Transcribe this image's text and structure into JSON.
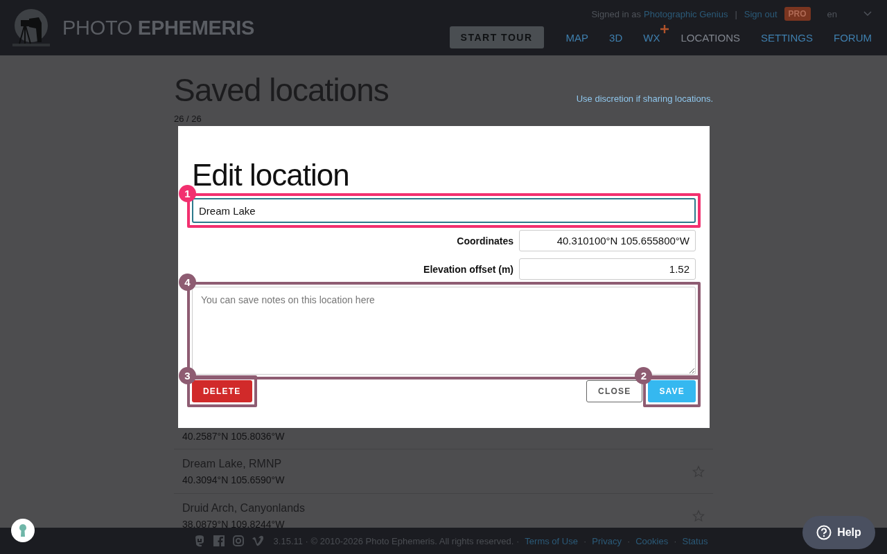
{
  "header": {
    "brand": {
      "light": "PHOTO",
      "bold": "EPHEMERIS"
    },
    "account": {
      "signed_in_label": "Signed in as",
      "user": "Photographic Genius",
      "separator": "|",
      "sign_out": "Sign out",
      "badge": "PRO"
    },
    "language": "en",
    "start_tour": "START TOUR",
    "nav": [
      {
        "label": "MAP",
        "selected": false,
        "new": false
      },
      {
        "label": "3D",
        "selected": false,
        "new": false
      },
      {
        "label": "WX",
        "selected": false,
        "new": true
      },
      {
        "label": "LOCATIONS",
        "selected": true,
        "new": false
      },
      {
        "label": "SETTINGS",
        "selected": false,
        "new": false
      },
      {
        "label": "FORUM",
        "selected": false,
        "new": false
      }
    ]
  },
  "page": {
    "title": "Saved locations",
    "notice": "Use discretion if sharing locations.",
    "count": "26 / 26",
    "locations": [
      {
        "coords": "40.2587°N 105.8036°W"
      },
      {
        "name": "Dream Lake, RMNP",
        "coords": "40.3094°N 105.6590°W",
        "favorite": false
      },
      {
        "name": "Druid Arch, Canyonlands",
        "coords": "38.0879°N 109.8244°W",
        "favorite": false
      }
    ]
  },
  "dialog": {
    "title": "Edit location",
    "name": {
      "value": "Dream Lake",
      "annotation": {
        "label": "1",
        "color": "#f2306f"
      }
    },
    "fields": [
      {
        "label": "Coordinates",
        "value": "40.310100°N 105.655800°W"
      },
      {
        "label": "Elevation offset (m)",
        "value": "1.52"
      }
    ],
    "notes": {
      "placeholder": "You can save notes on this location here",
      "annotation": {
        "label": "4",
        "color": "#8e5c72"
      }
    },
    "buttons": [
      {
        "kind": "delete",
        "label": "DELETE",
        "annotation": {
          "label": "3",
          "color": "#8e5c72"
        }
      },
      {
        "kind": "close",
        "label": "CLOSE"
      },
      {
        "kind": "save",
        "label": "SAVE",
        "annotation": {
          "label": "2",
          "color": "#8e5c72"
        }
      }
    ]
  },
  "footer": {
    "text": "3.15.11 · © 2010-2026 Photo Ephemeris. All rights reserved. ·",
    "separator": "·",
    "links": [
      "Terms of Use",
      "Privacy",
      "Cookies",
      "Status"
    ]
  },
  "help_button": {
    "label": "Help"
  }
}
